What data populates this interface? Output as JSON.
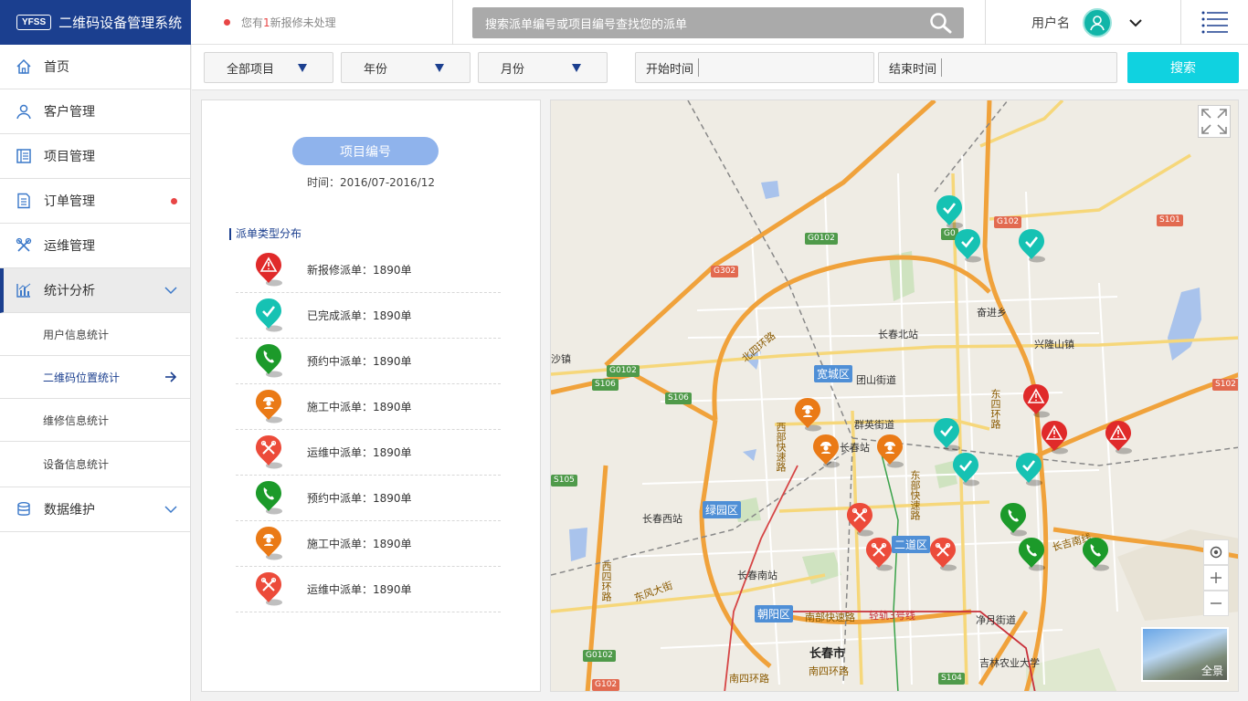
{
  "app": {
    "logo_badge": "YFSS",
    "title": "二维码设备管理系统"
  },
  "header": {
    "notice_prefix": "您有",
    "notice_count": "1",
    "notice_suffix": "新报修未处理",
    "search_placeholder": "搜索派单编号或项目编号查找您的派单",
    "username": "用户名"
  },
  "sidebar": {
    "items": [
      {
        "label": "首页",
        "icon": "home-icon"
      },
      {
        "label": "客户管理",
        "icon": "user-icon"
      },
      {
        "label": "项目管理",
        "icon": "project-icon"
      },
      {
        "label": "订单管理",
        "icon": "order-icon",
        "has_dot": true
      },
      {
        "label": "运维管理",
        "icon": "tools-icon"
      },
      {
        "label": "统计分析",
        "icon": "chart-icon",
        "expanded": true
      },
      {
        "label": "数据维护",
        "icon": "database-icon"
      }
    ],
    "sub_items": [
      {
        "label": "用户信息统计"
      },
      {
        "label": "二维码位置统计",
        "selected": true
      },
      {
        "label": "维修信息统计"
      },
      {
        "label": "设备信息统计"
      }
    ]
  },
  "filters": {
    "project": "全部项目",
    "year": "年份",
    "month": "月份",
    "start_label": "开始时间",
    "end_label": "结束时间",
    "search_button": "搜索"
  },
  "panel": {
    "project_button": "项目编号",
    "period": "时间：2016/07-2016/12",
    "dist_title": "派单类型分布",
    "legend": [
      {
        "label": "新报修派单：1890单",
        "type": "alert"
      },
      {
        "label": "已完成派单：1890单",
        "type": "done"
      },
      {
        "label": "预约中派单：1890单",
        "type": "phone"
      },
      {
        "label": "施工中派单：1890单",
        "type": "worker"
      },
      {
        "label": "运维中派单：1890单",
        "type": "tools"
      },
      {
        "label": "预约中派单：1890单",
        "type": "phone"
      },
      {
        "label": "施工中派单：1890单",
        "type": "worker"
      },
      {
        "label": "运维中派单：1890单",
        "type": "tools"
      }
    ]
  },
  "map": {
    "labels": {
      "changchun_north": "长春北站",
      "tuanshan": "团山街道",
      "qunying": "群英街道",
      "changchun_station": "长春站",
      "changchun_west": "长春西站",
      "changchun_south": "长春南站",
      "city": "长春市",
      "fenjin": "奋进乡",
      "xinglongshan": "兴隆山镇",
      "jingyue": "净月街道",
      "jilin_agri": "吉林农业大学",
      "west_town": "沙镇",
      "north_ring": "北四环路",
      "east_ring": "东四环路",
      "south_ring": "南四环路",
      "south4": "南四环路",
      "west_ring": "西四环路",
      "dongfeng": "东风大街",
      "east_express": "东部快速路",
      "west_express": "西部快速路",
      "south_express": "南部快速路",
      "changji": "长吉南线",
      "light_rail": "轻轨3号线"
    },
    "districts": {
      "kuancheng": "宽城区",
      "lvyuan": "绿园区",
      "erdao": "二道区",
      "chaoyang": "朝阳区"
    },
    "shields": [
      "G0102",
      "G302",
      "G0102",
      "S106",
      "S106",
      "G102",
      "S101",
      "G0",
      "S102",
      "S105",
      "G0102",
      "G102",
      "S104"
    ],
    "pano_label": "全景"
  },
  "colors": {
    "brand": "#1b3f8f",
    "accent": "#10d2e0",
    "alert": "#e02a2a",
    "done": "#16c2b3",
    "phone": "#1c9a2a",
    "worker": "#ea7a16",
    "tools": "#ec4b3a"
  }
}
